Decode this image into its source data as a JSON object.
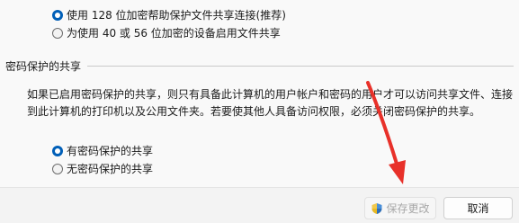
{
  "encryption": {
    "option_128": "使用 128 位加密帮助保护文件共享连接(推荐)",
    "option_40_56": "为使用 40 或 56 位加密的设备启用文件共享"
  },
  "password_protection": {
    "section_title": "密码保护的共享",
    "description": "如果已启用密码保护的共享，则只有具备此计算机的用户帐户和密码的用户才可以访问共享文件、连接到此计算机的打印机以及公用文件夹。若要使其他人具备访问权限，必须关闭密码保护的共享。",
    "option_on": "有密码保护的共享",
    "option_off": "无密码保护的共享"
  },
  "footer": {
    "save_label": "保存更改",
    "cancel_label": "取消"
  },
  "colors": {
    "accent": "#005fb8",
    "annotation_arrow": "#e8312a"
  },
  "icons": {
    "save": "shield-icon"
  }
}
